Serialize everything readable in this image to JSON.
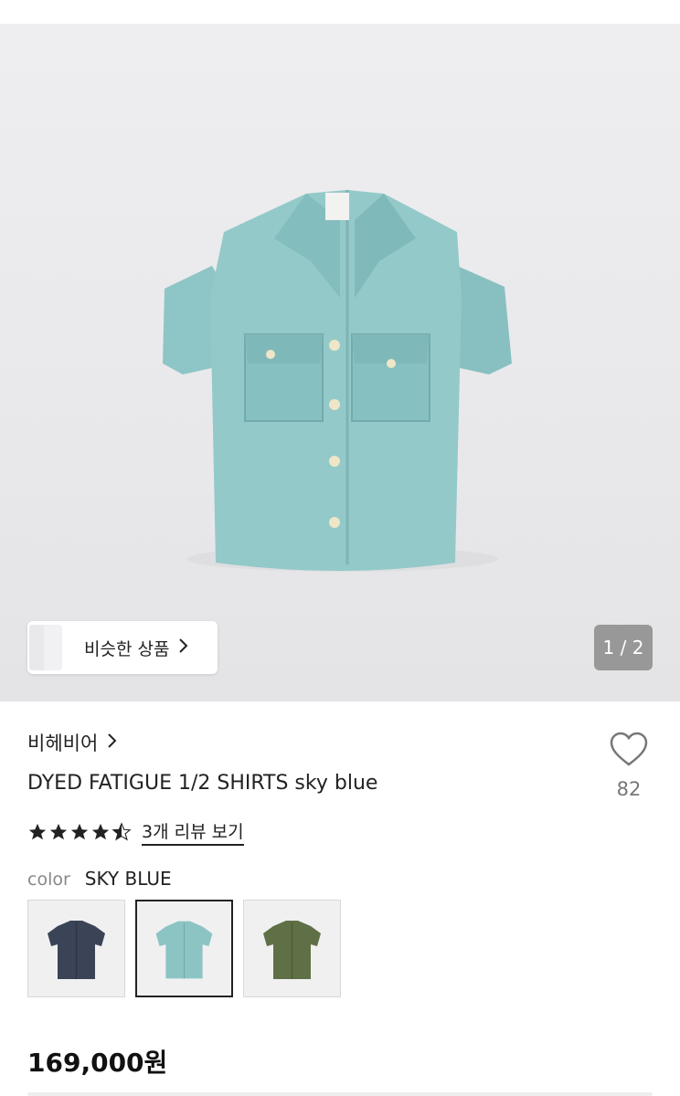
{
  "hero": {
    "image_alt": "sky blue fatigue shirt",
    "similar_label": "비슷한 상품",
    "page_counter": "1 / 2"
  },
  "product": {
    "brand": "비헤비어",
    "title": "DYED FATIGUE 1/2 SHIRTS sky blue",
    "like_count": "82",
    "rating": 4.5,
    "review_link": "3개 리뷰 보기",
    "color_label": "color",
    "color_value": "SKY BLUE",
    "price": "169,000원"
  },
  "swatches": [
    {
      "name": "navy",
      "color": "#3a4456",
      "selected": false
    },
    {
      "name": "sky blue",
      "color": "#8cc4c4",
      "selected": true
    },
    {
      "name": "olive",
      "color": "#5f7046",
      "selected": false
    }
  ],
  "colors": {
    "shirt_main": "#93c9c9",
    "shirt_shadow": "#7fb8b9",
    "star": "#222222"
  },
  "icons": {
    "heart": "heart-icon",
    "chevron": "chevron-right-icon",
    "star": "star-icon"
  }
}
